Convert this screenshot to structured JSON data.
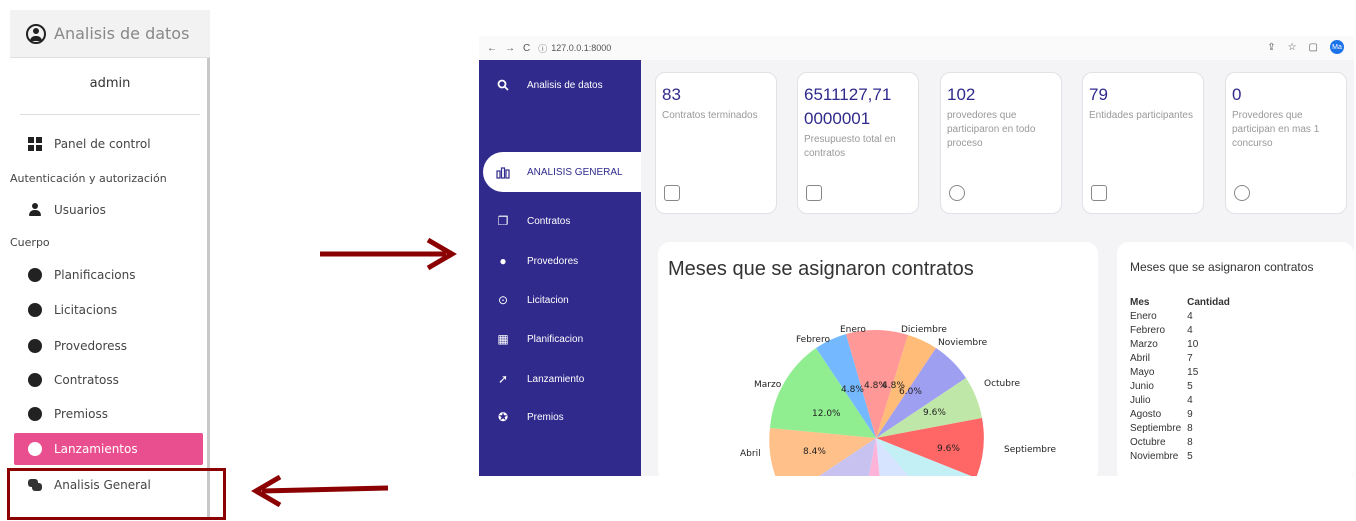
{
  "admin": {
    "brand": "Analisis de datos",
    "user": "admin",
    "items": [
      {
        "label": "Panel de control"
      },
      {
        "header": "Autenticación y autorización"
      },
      {
        "label": "Usuarios"
      },
      {
        "header": "Cuerpo"
      },
      {
        "label": "Planificacions"
      },
      {
        "label": "Licitacions"
      },
      {
        "label": "Provedoress"
      },
      {
        "label": "Contratoss"
      },
      {
        "label": "Premioss"
      },
      {
        "label": "Lanzamientos"
      },
      {
        "label": "Analisis General"
      }
    ],
    "active_color": "#e94e8e",
    "highlight_color": "#8b0000"
  },
  "browser": {
    "url": "127.0.0.1:8000",
    "avatar": "Ma"
  },
  "sidebar": {
    "brand": "Analisis de datos",
    "items": [
      {
        "label": "ANALISIS GENERAL",
        "icon": "bar-chart-icon"
      },
      {
        "label": "Contratos",
        "icon": "copy-icon"
      },
      {
        "label": "Provedores",
        "icon": "group-icon"
      },
      {
        "label": "Licitacion",
        "icon": "money-icon"
      },
      {
        "label": "Planificacion",
        "icon": "calendar-icon"
      },
      {
        "label": "Lanzamiento",
        "icon": "rocket-icon"
      },
      {
        "label": "Premios",
        "icon": "award-icon"
      }
    ],
    "bg_color": "#2f2a8c"
  },
  "cards": [
    {
      "value": "83",
      "label": "Contratos terminados",
      "icon": "copy-icon"
    },
    {
      "value_line1": "6511127,71",
      "value_line2": "0000001",
      "label": "Presupuesto total en contratos",
      "icon": "money-icon"
    },
    {
      "value": "102",
      "label": "provedores que participaron en todo proceso",
      "icon": "group-icon"
    },
    {
      "value": "79",
      "label": "Entidades participantes",
      "icon": "building-icon"
    },
    {
      "value": "0",
      "label": "Provedores que participan en mas 1 concurso",
      "icon": "group-icon"
    }
  ],
  "pie": {
    "title": "Meses que se asignaron contratos",
    "labels": [
      "Enero",
      "Febrero",
      "Marzo",
      "Abril",
      "Septiembre",
      "Octubre",
      "Noviembre",
      "Diciembre"
    ],
    "percents": [
      "4.8%",
      "4.8%",
      "12.0%",
      "8.4%",
      "9.6%",
      "9.6%",
      "6.0%",
      "4.8%"
    ]
  },
  "table": {
    "title": "Meses que se asignaron contratos",
    "headers": [
      "Mes",
      "Cantidad"
    ],
    "rows": [
      [
        "Enero",
        "4"
      ],
      [
        "Febrero",
        "4"
      ],
      [
        "Marzo",
        "10"
      ],
      [
        "Abril",
        "7"
      ],
      [
        "Mayo",
        "15"
      ],
      [
        "Junio",
        "5"
      ],
      [
        "Julio",
        "4"
      ],
      [
        "Agosto",
        "9"
      ],
      [
        "Septiembre",
        "8"
      ],
      [
        "Octubre",
        "8"
      ],
      [
        "Noviembre",
        "5"
      ]
    ]
  }
}
